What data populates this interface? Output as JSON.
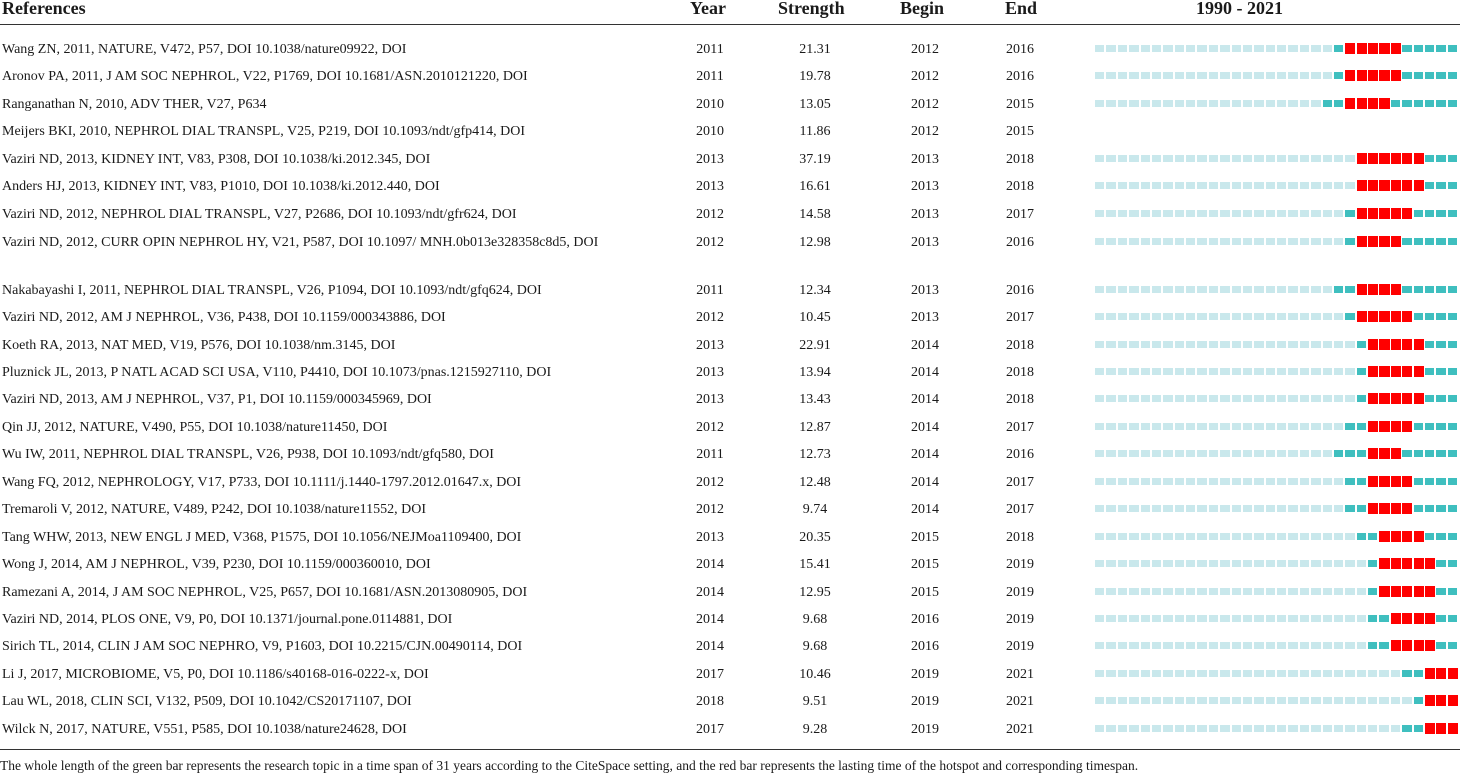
{
  "header": {
    "references": "References",
    "year": "Year",
    "strength": "Strength",
    "begin": "Begin",
    "end": "End",
    "range": "1990 - 2021"
  },
  "timeline": {
    "start_year": 1990,
    "end_year": 2021,
    "colors": {
      "inactive": "#c9e8ec",
      "active": "#3fbfbf",
      "burst": "#ff0000"
    }
  },
  "rows": [
    {
      "ref": "Wang ZN, 2011, NATURE, V472, P57, DOI 10.1038/nature09922, DOI",
      "year": "2011",
      "strength": "21.31",
      "begin": "2012",
      "end": "2016",
      "show_bar": true
    },
    {
      "ref": "Aronov PA, 2011, J AM SOC NEPHROL, V22, P1769, DOI 10.1681/ASN.2010121220, DOI",
      "year": "2011",
      "strength": "19.78",
      "begin": "2012",
      "end": "2016",
      "show_bar": true
    },
    {
      "ref": "Ranganathan N, 2010, ADV THER, V27, P634",
      "year": "2010",
      "strength": "13.05",
      "begin": "2012",
      "end": "2015",
      "show_bar": true
    },
    {
      "ref": "Meijers BKI, 2010, NEPHROL DIAL TRANSPL, V25, P219, DOI 10.1093/ndt/gfp414, DOI",
      "year": "2010",
      "strength": "11.86",
      "begin": "2012",
      "end": "2015",
      "show_bar": false
    },
    {
      "ref": "Vaziri ND, 2013, KIDNEY INT, V83, P308, DOI 10.1038/ki.2012.345, DOI",
      "year": "2013",
      "strength": "37.19",
      "begin": "2013",
      "end": "2018",
      "show_bar": true
    },
    {
      "ref": "Anders HJ, 2013, KIDNEY INT, V83, P1010, DOI 10.1038/ki.2012.440, DOI",
      "year": "2013",
      "strength": "16.61",
      "begin": "2013",
      "end": "2018",
      "show_bar": true
    },
    {
      "ref": "Vaziri ND, 2012, NEPHROL DIAL TRANSPL, V27, P2686, DOI 10.1093/ndt/gfr624, DOI",
      "year": "2012",
      "strength": "14.58",
      "begin": "2013",
      "end": "2017",
      "show_bar": true
    },
    {
      "ref": "Vaziri ND, 2012, CURR OPIN NEPHROL HY, V21, P587, DOI 10.1097/ MNH.0b013e328358c8d5, DOI",
      "year": "2012",
      "strength": "12.98",
      "begin": "2013",
      "end": "2016",
      "show_bar": true,
      "two_line": true
    },
    {
      "ref": "Nakabayashi I, 2011, NEPHROL DIAL TRANSPL, V26, P1094, DOI 10.1093/ndt/gfq624, DOI",
      "year": "2011",
      "strength": "12.34",
      "begin": "2013",
      "end": "2016",
      "show_bar": true
    },
    {
      "ref": "Vaziri ND, 2012, AM J NEPHROL, V36, P438, DOI 10.1159/000343886, DOI",
      "year": "2012",
      "strength": "10.45",
      "begin": "2013",
      "end": "2017",
      "show_bar": true
    },
    {
      "ref": "Koeth RA, 2013, NAT MED, V19, P576, DOI 10.1038/nm.3145, DOI",
      "year": "2013",
      "strength": "22.91",
      "begin": "2014",
      "end": "2018",
      "show_bar": true
    },
    {
      "ref": "Pluznick JL, 2013, P NATL ACAD SCI USA, V110, P4410, DOI 10.1073/pnas.1215927110, DOI",
      "year": "2013",
      "strength": "13.94",
      "begin": "2014",
      "end": "2018",
      "show_bar": true
    },
    {
      "ref": "Vaziri ND, 2013, AM J NEPHROL, V37, P1, DOI 10.1159/000345969, DOI",
      "year": "2013",
      "strength": "13.43",
      "begin": "2014",
      "end": "2018",
      "show_bar": true
    },
    {
      "ref": "Qin JJ, 2012, NATURE, V490, P55, DOI 10.1038/nature11450, DOI",
      "year": "2012",
      "strength": "12.87",
      "begin": "2014",
      "end": "2017",
      "show_bar": true
    },
    {
      "ref": "Wu IW, 2011, NEPHROL DIAL TRANSPL, V26, P938, DOI 10.1093/ndt/gfq580, DOI",
      "year": "2011",
      "strength": "12.73",
      "begin": "2014",
      "end": "2016",
      "show_bar": true
    },
    {
      "ref": "Wang FQ, 2012, NEPHROLOGY, V17, P733, DOI 10.1111/j.1440-1797.2012.01647.x, DOI",
      "year": "2012",
      "strength": "12.48",
      "begin": "2014",
      "end": "2017",
      "show_bar": true
    },
    {
      "ref": "Tremaroli V, 2012, NATURE, V489, P242, DOI 10.1038/nature11552, DOI",
      "year": "2012",
      "strength": "9.74",
      "begin": "2014",
      "end": "2017",
      "show_bar": true
    },
    {
      "ref": "Tang WHW, 2013, NEW ENGL J MED, V368, P1575, DOI 10.1056/NEJMoa1109400, DOI",
      "year": "2013",
      "strength": "20.35",
      "begin": "2015",
      "end": "2018",
      "show_bar": true
    },
    {
      "ref": "Wong J, 2014, AM J NEPHROL, V39, P230, DOI 10.1159/000360010, DOI",
      "year": "2014",
      "strength": "15.41",
      "begin": "2015",
      "end": "2019",
      "show_bar": true
    },
    {
      "ref": "Ramezani A, 2014, J AM SOC NEPHROL, V25, P657, DOI 10.1681/ASN.2013080905, DOI",
      "year": "2014",
      "strength": "12.95",
      "begin": "2015",
      "end": "2019",
      "show_bar": true
    },
    {
      "ref": "Vaziri ND, 2014, PLOS ONE, V9, P0, DOI 10.1371/journal.pone.0114881, DOI",
      "year": "2014",
      "strength": "9.68",
      "begin": "2016",
      "end": "2019",
      "show_bar": true
    },
    {
      "ref": "Sirich TL, 2014, CLIN J AM SOC NEPHRO, V9, P1603, DOI 10.2215/CJN.00490114, DOI",
      "year": "2014",
      "strength": "9.68",
      "begin": "2016",
      "end": "2019",
      "show_bar": true
    },
    {
      "ref": "Li J, 2017, MICROBIOME, V5, P0, DOI 10.1186/s40168-016-0222-x, DOI",
      "year": "2017",
      "strength": "10.46",
      "begin": "2019",
      "end": "2021",
      "show_bar": true
    },
    {
      "ref": "Lau WL, 2018, CLIN SCI, V132, P509, DOI 10.1042/CS20171107, DOI",
      "year": "2018",
      "strength": "9.51",
      "begin": "2019",
      "end": "2021",
      "show_bar": true
    },
    {
      "ref": "Wilck N, 2017, NATURE, V551, P585, DOI 10.1038/nature24628, DOI",
      "year": "2017",
      "strength": "9.28",
      "begin": "2019",
      "end": "2021",
      "show_bar": true
    }
  ],
  "footnote": "The whole length of the green bar represents the research topic in a time span of 31 years according to the CiteSpace setting, and the red bar represents the lasting time of the hotspot and corresponding timespan."
}
